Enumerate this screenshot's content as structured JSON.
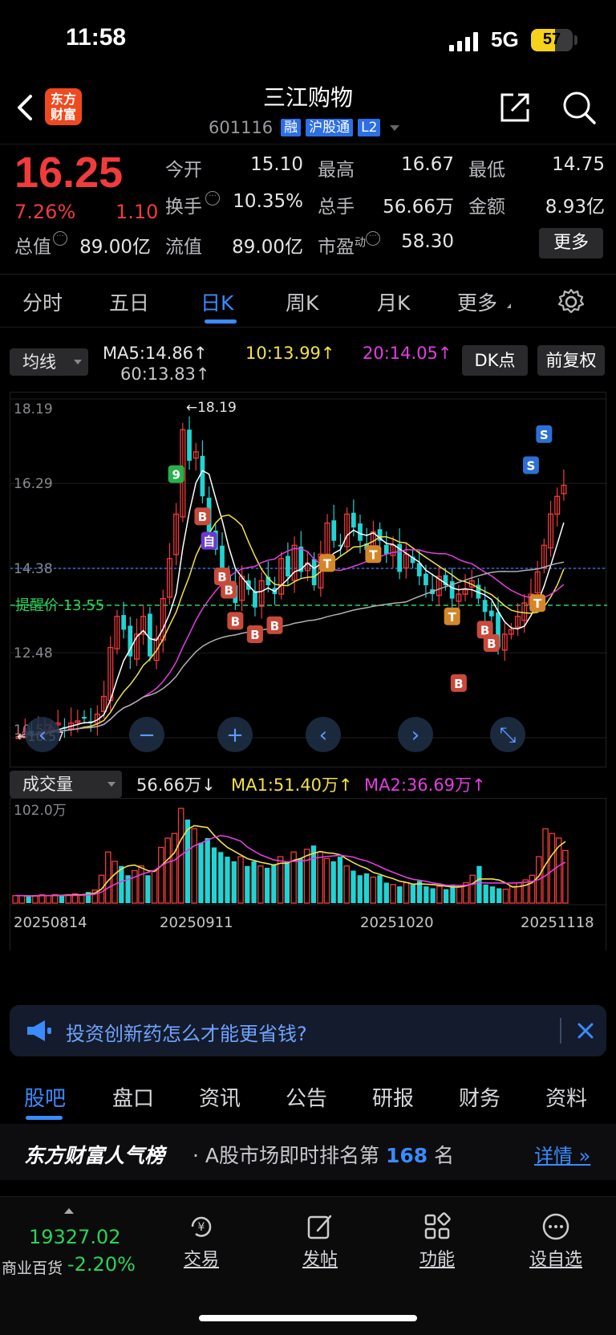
{
  "status": {
    "time": "11:58",
    "network": "5G",
    "battery": 57
  },
  "header": {
    "logo_text": "东方财富",
    "title": "三江购物",
    "code": "601116",
    "tags": [
      "融",
      "沪股通",
      "L2"
    ]
  },
  "quote": {
    "price": "16.25",
    "change_pct": "7.26%",
    "change": "1.10",
    "open_label": "今开",
    "open": "15.10",
    "high_label": "最高",
    "high": "16.67",
    "low_label": "最低",
    "low": "14.75",
    "turnover_label": "换手",
    "turnover": "10.35%",
    "volume_label": "总手",
    "volume": "56.66万",
    "amount_label": "金额",
    "amount": "8.93亿",
    "mktcap_label": "总值",
    "mktcap": "89.00亿",
    "float_label": "流值",
    "float": "89.00亿",
    "pe_label": "市盈",
    "pe_sup": "动",
    "pe": "58.30",
    "more_label": "更多"
  },
  "periods": [
    "分时",
    "五日",
    "日K",
    "周K",
    "月K",
    "更多"
  ],
  "active_period": 2,
  "kline_toolbar": {
    "indicator": "均线",
    "ma5": "MA5:14.86",
    "ma10": "10:13.99",
    "ma20": "20:14.05",
    "ma60": "60:13.83",
    "dk_button": "DK点",
    "adjust_button": "前复权"
  },
  "volume_toolbar": {
    "indicator": "成交量",
    "vol": "56.66万",
    "ma1": "MA1:51.40万",
    "ma2": "MA2:36.69万"
  },
  "chart_data": [
    {
      "type": "candlestick",
      "title": "三江购物 日K",
      "y_ticks": [
        "18.19",
        "16.29",
        "14.38",
        "12.48",
        "10.57"
      ],
      "ylim": [
        10.57,
        18.19
      ],
      "max_label": "18.19",
      "min_label": "10.57",
      "alert_label": "提醒价 13.55",
      "alert_price": 13.55,
      "current_price": 14.38,
      "close_series": [
        10.6,
        10.7,
        10.6,
        10.7,
        10.75,
        10.8,
        10.9,
        10.8,
        10.9,
        10.95,
        11.0,
        10.9,
        11.1,
        11.5,
        12.6,
        13.3,
        13.0,
        12.4,
        12.9,
        13.3,
        12.4,
        12.8,
        13.7,
        14.6,
        15.6,
        17.5,
        16.8,
        17.0,
        16.0,
        15.2,
        14.8,
        14.3,
        14.0,
        13.6,
        14.2,
        13.9,
        13.5,
        14.1,
        14.0,
        13.8,
        14.6,
        14.2,
        14.9,
        14.3,
        14.5,
        14.0,
        14.7,
        15.4,
        15.0,
        14.9,
        15.6,
        15.3,
        15.0,
        14.8,
        15.2,
        15.0,
        14.7,
        14.9,
        14.3,
        14.7,
        14.5,
        14.2,
        14.0,
        13.8,
        14.2,
        14.0,
        13.7,
        13.8,
        13.9,
        14.1,
        13.7,
        13.4,
        13.3,
        12.6,
        12.9,
        13.0,
        13.3,
        13.6,
        13.8,
        14.3,
        14.9,
        15.6,
        16.0,
        16.25
      ],
      "markers": [
        "B",
        "S",
        "T",
        "9",
        "自"
      ]
    },
    {
      "type": "bar",
      "title": "成交量",
      "y_ticks": [
        "102.0万"
      ],
      "ylim": [
        0,
        102.0
      ],
      "x_ticks": [
        "20250814",
        "20250911",
        "20251020",
        "20251118"
      ],
      "values": [
        8,
        8,
        7,
        8,
        9,
        8,
        9,
        8,
        9,
        10,
        9,
        12,
        14,
        30,
        55,
        45,
        40,
        30,
        35,
        40,
        30,
        35,
        60,
        70,
        75,
        102,
        90,
        80,
        65,
        70,
        60,
        55,
        50,
        45,
        50,
        40,
        45,
        40,
        38,
        42,
        50,
        45,
        55,
        48,
        58,
        62,
        55,
        48,
        45,
        50,
        40,
        35,
        30,
        32,
        28,
        30,
        22,
        20,
        18,
        22,
        20,
        24,
        18,
        16,
        18,
        15,
        20,
        18,
        22,
        30,
        40,
        20,
        18,
        16,
        15,
        18,
        22,
        25,
        30,
        50,
        80,
        75,
        70,
        56.66
      ]
    }
  ],
  "banner": {
    "text": "投资创新药怎么才能更省钱?"
  },
  "tabs": [
    "股吧",
    "盘口",
    "资讯",
    "公告",
    "研报",
    "财务",
    "资料"
  ],
  "rank": {
    "title": "东方财富人气榜",
    "text_prefix": "· A股市场即时排名第",
    "rank": "168",
    "text_suffix": "名",
    "link": "详情"
  },
  "bottom": {
    "index_value": "19327.02",
    "index_name": "商业百货",
    "index_change": "-2.20%",
    "items": [
      "交易",
      "发帖",
      "功能",
      "设自选"
    ]
  }
}
